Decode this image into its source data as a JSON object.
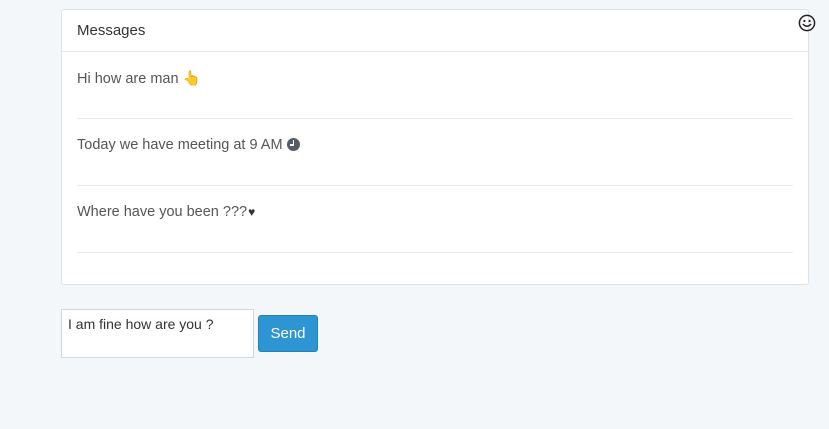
{
  "panel": {
    "title": "Messages"
  },
  "messages": [
    {
      "text": "Hi how are man",
      "emoji": "👆"
    },
    {
      "text": "Today we have meeting at 9 AM",
      "emoji": "clock-icon"
    },
    {
      "text": "Where have you been ???",
      "emoji": "♥"
    }
  ],
  "reply": {
    "value": "I am fine how are you ?"
  },
  "send_label": "Send",
  "icons": {
    "emoji_picker": "smiley-icon"
  },
  "colors": {
    "background": "#f4f7fa",
    "send_button": "#2e95d3"
  }
}
